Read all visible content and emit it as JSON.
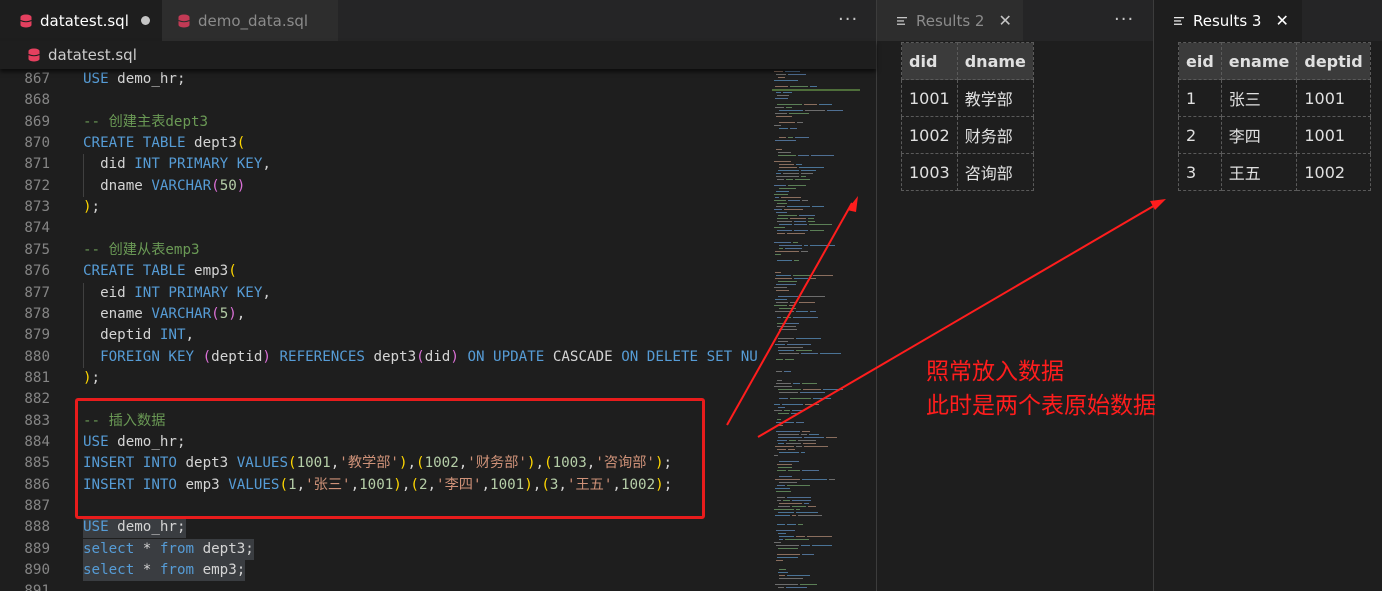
{
  "editor": {
    "tabs": [
      {
        "label": "datatest.sql",
        "active": true,
        "modified": true
      },
      {
        "label": "demo_data.sql",
        "active": false
      }
    ],
    "more_label": "···",
    "breadcrumb": "datatest.sql",
    "lines": [
      {
        "n": "867",
        "indent": false,
        "parts": [
          [
            "kw",
            "USE"
          ],
          [
            "tx",
            " demo_hr;"
          ]
        ]
      },
      {
        "n": "868",
        "indent": false,
        "parts": []
      },
      {
        "n": "869",
        "indent": false,
        "parts": [
          [
            "cm",
            "-- 创建主表dept3"
          ]
        ]
      },
      {
        "n": "870",
        "indent": false,
        "parts": [
          [
            "kw",
            "CREATE TABLE"
          ],
          [
            "tx",
            " dept3"
          ],
          [
            "pr",
            "("
          ]
        ]
      },
      {
        "n": "871",
        "indent": true,
        "parts": [
          [
            "tx",
            "  did "
          ],
          [
            "kw",
            "INT PRIMARY KEY"
          ],
          [
            "tx",
            ","
          ]
        ]
      },
      {
        "n": "872",
        "indent": true,
        "parts": [
          [
            "tx",
            "  dname "
          ],
          [
            "kw",
            "VARCHAR"
          ],
          [
            "pp",
            "("
          ],
          [
            "nm",
            "50"
          ],
          [
            "pp",
            ")"
          ]
        ]
      },
      {
        "n": "873",
        "indent": false,
        "parts": [
          [
            "pr",
            ")"
          ],
          [
            "tx",
            ";"
          ]
        ]
      },
      {
        "n": "874",
        "indent": false,
        "parts": []
      },
      {
        "n": "875",
        "indent": false,
        "parts": [
          [
            "cm",
            "-- 创建从表emp3"
          ]
        ]
      },
      {
        "n": "876",
        "indent": false,
        "parts": [
          [
            "kw",
            "CREATE TABLE"
          ],
          [
            "tx",
            " emp3"
          ],
          [
            "pr",
            "("
          ]
        ]
      },
      {
        "n": "877",
        "indent": true,
        "parts": [
          [
            "tx",
            "  eid "
          ],
          [
            "kw",
            "INT PRIMARY KEY"
          ],
          [
            "tx",
            ","
          ]
        ]
      },
      {
        "n": "878",
        "indent": true,
        "parts": [
          [
            "tx",
            "  ename "
          ],
          [
            "kw",
            "VARCHAR"
          ],
          [
            "pp",
            "("
          ],
          [
            "nm",
            "5"
          ],
          [
            "pp",
            ")"
          ],
          [
            "tx",
            ","
          ]
        ]
      },
      {
        "n": "879",
        "indent": true,
        "parts": [
          [
            "tx",
            "  deptid "
          ],
          [
            "kw",
            "INT"
          ],
          [
            "tx",
            ","
          ]
        ]
      },
      {
        "n": "880",
        "indent": true,
        "parts": [
          [
            "tx",
            "  "
          ],
          [
            "kw",
            "FOREIGN KEY"
          ],
          [
            "tx",
            " "
          ],
          [
            "pp",
            "("
          ],
          [
            "tx",
            "deptid"
          ],
          [
            "pp",
            ")"
          ],
          [
            "tx",
            " "
          ],
          [
            "kw",
            "REFERENCES"
          ],
          [
            "tx",
            " dept3"
          ],
          [
            "pp",
            "("
          ],
          [
            "tx",
            "did"
          ],
          [
            "pp",
            ")"
          ],
          [
            "tx",
            " "
          ],
          [
            "kw",
            "ON UPDATE"
          ],
          [
            "tx",
            " CASCADE "
          ],
          [
            "kw",
            "ON DELETE SET NU"
          ]
        ]
      },
      {
        "n": "881",
        "indent": false,
        "parts": [
          [
            "pr",
            ")"
          ],
          [
            "tx",
            ";"
          ]
        ]
      },
      {
        "n": "882",
        "indent": false,
        "parts": []
      },
      {
        "n": "883",
        "indent": false,
        "parts": [
          [
            "cm",
            "-- 插入数据"
          ]
        ]
      },
      {
        "n": "884",
        "indent": false,
        "parts": [
          [
            "kw",
            "USE"
          ],
          [
            "tx",
            " demo_hr;"
          ]
        ]
      },
      {
        "n": "885",
        "indent": false,
        "parts": [
          [
            "kw",
            "INSERT INTO"
          ],
          [
            "tx",
            " dept3 "
          ],
          [
            "kw",
            "VALUES"
          ],
          [
            "pr",
            "("
          ],
          [
            "nm",
            "1001"
          ],
          [
            "tx",
            ","
          ],
          [
            "st",
            "'教学部'"
          ],
          [
            "pr",
            ")"
          ],
          [
            "tx",
            ","
          ],
          [
            "pr",
            "("
          ],
          [
            "nm",
            "1002"
          ],
          [
            "tx",
            ","
          ],
          [
            "st",
            "'财务部'"
          ],
          [
            "pr",
            ")"
          ],
          [
            "tx",
            ","
          ],
          [
            "pr",
            "("
          ],
          [
            "nm",
            "1003"
          ],
          [
            "tx",
            ","
          ],
          [
            "st",
            "'咨询部'"
          ],
          [
            "pr",
            ")"
          ],
          [
            "tx",
            ";"
          ]
        ]
      },
      {
        "n": "886",
        "indent": false,
        "parts": [
          [
            "kw",
            "INSERT INTO"
          ],
          [
            "tx",
            " emp3 "
          ],
          [
            "kw",
            "VALUES"
          ],
          [
            "pr",
            "("
          ],
          [
            "nm",
            "1"
          ],
          [
            "tx",
            ","
          ],
          [
            "st",
            "'张三'"
          ],
          [
            "tx",
            ","
          ],
          [
            "nm",
            "1001"
          ],
          [
            "pr",
            ")"
          ],
          [
            "tx",
            ","
          ],
          [
            "pr",
            "("
          ],
          [
            "nm",
            "2"
          ],
          [
            "tx",
            ","
          ],
          [
            "st",
            "'李四'"
          ],
          [
            "tx",
            ","
          ],
          [
            "nm",
            "1001"
          ],
          [
            "pr",
            ")"
          ],
          [
            "tx",
            ","
          ],
          [
            "pr",
            "("
          ],
          [
            "nm",
            "3"
          ],
          [
            "tx",
            ","
          ],
          [
            "st",
            "'王五'"
          ],
          [
            "tx",
            ","
          ],
          [
            "nm",
            "1002"
          ],
          [
            "pr",
            ")"
          ],
          [
            "tx",
            ";"
          ]
        ]
      },
      {
        "n": "887",
        "indent": false,
        "parts": []
      },
      {
        "n": "888",
        "indent": false,
        "sel": true,
        "parts": [
          [
            "kw",
            "USE"
          ],
          [
            "tx",
            " demo_hr;"
          ]
        ]
      },
      {
        "n": "889",
        "indent": false,
        "sel": true,
        "parts": [
          [
            "kw",
            "select"
          ],
          [
            "tx",
            " * "
          ],
          [
            "kw",
            "from"
          ],
          [
            "tx",
            " dept3;"
          ]
        ]
      },
      {
        "n": "890",
        "indent": false,
        "sel": true,
        "parts": [
          [
            "kw",
            "select"
          ],
          [
            "tx",
            " * "
          ],
          [
            "kw",
            "from"
          ],
          [
            "tx",
            " emp3;"
          ]
        ]
      },
      {
        "n": "891",
        "indent": false,
        "parts": []
      }
    ]
  },
  "results2": {
    "tab_label": "Results 2",
    "more_label": "···",
    "close_label": "✕",
    "columns": [
      "did",
      "dname"
    ],
    "rows": [
      [
        "1001",
        "教学部"
      ],
      [
        "1002",
        "财务部"
      ],
      [
        "1003",
        "咨询部"
      ]
    ]
  },
  "results3": {
    "tab_label": "Results 3",
    "close_label": "✕",
    "columns": [
      "eid",
      "ename",
      "deptid"
    ],
    "rows": [
      [
        "1",
        "张三",
        "1001"
      ],
      [
        "2",
        "李四",
        "1001"
      ],
      [
        "3",
        "王五",
        "1002"
      ]
    ]
  },
  "annotation": {
    "line1": "照常放入数据",
    "line2": "此时是两个表原始数据",
    "color": "#ff1d1d"
  },
  "colors": {
    "keyword": "#569cd6",
    "comment": "#6a9955",
    "string": "#ce9178",
    "number": "#b5cea8",
    "bracket_outer": "#ffd700",
    "bracket_inner": "#da70d6"
  }
}
